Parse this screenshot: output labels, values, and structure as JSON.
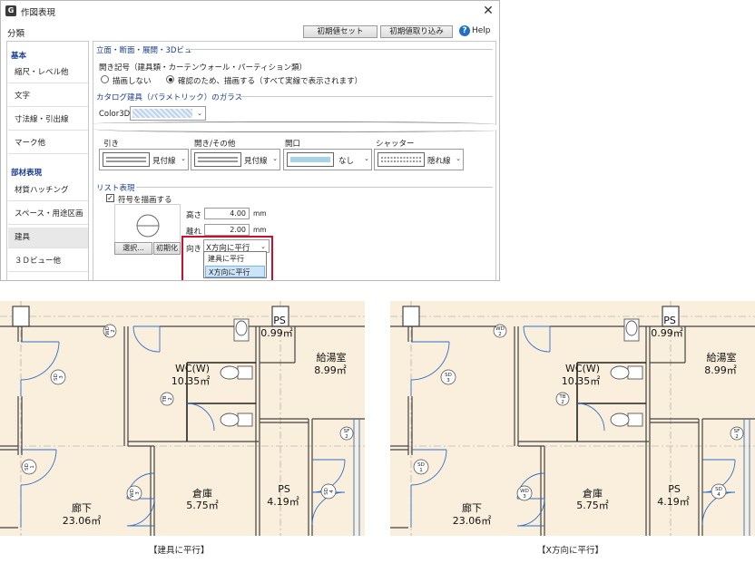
{
  "dialog": {
    "title": "作図表現",
    "close": "✕",
    "category_label": "分類",
    "buttons": {
      "initial_set": "初期値セット",
      "initial_load": "初期値取り込み"
    },
    "help": "Help"
  },
  "sidebar": {
    "head1": "基本",
    "items1": [
      "縮尺・レベル他",
      "文字",
      "寸法線・引出線",
      "マーク他"
    ],
    "head2": "部材表現",
    "items2": [
      "材質ハッチング",
      "スペース・用途区画",
      "建具",
      "３Ｄビュー他"
    ],
    "selected": "建具"
  },
  "panel": {
    "section_elev": "立面・断面・展開・3Dビュー",
    "opening_symbol_label": "開き記号（建具類・カーテンウォール・パーティション類）",
    "radio_no_draw": "描画しない",
    "radio_draw": "確認のため、描画する（すべて実線で表示されます）",
    "section_glass": "カタログ建具（パラメトリック）のガラス",
    "color3d_label": "Color3D",
    "line_types": [
      {
        "heading": "引き",
        "value": "見付線"
      },
      {
        "heading": "開き/その他",
        "value": "見付線"
      },
      {
        "heading": "開口",
        "value": "なし"
      },
      {
        "heading": "シャッター",
        "value": "隠れ線"
      }
    ],
    "section_list": "リスト表現",
    "draw_symbol_check": "符号を描画する",
    "height_label": "高さ",
    "height_value": "4.00",
    "height_unit": "mm",
    "offset_label": "離れ",
    "offset_value": "2.00",
    "offset_unit": "mm",
    "select_button": "選択...",
    "init_button": "初期化",
    "direction_label": "向き",
    "direction_value": "X方向に平行",
    "direction_options": [
      "建具に平行",
      "X方向に平行"
    ]
  },
  "plans": {
    "rooms": {
      "ps_top": "PS",
      "ps_top_area": "0.99㎡",
      "kyuto": "給湯室",
      "kyuto_area": "8.99㎡",
      "wc": "WC(W)",
      "wc_area": "10.35㎡",
      "souko": "倉庫",
      "souko_area": "5.75㎡",
      "ps_bottom": "PS",
      "ps_bottom_area": "4.19㎡",
      "rouka": "廊下",
      "rouka_area": "23.06㎡"
    },
    "tags": {
      "wd2": [
        "WD",
        "2"
      ],
      "sd3": [
        "SD",
        "3"
      ],
      "tb2": [
        "TB",
        "2"
      ],
      "sf2": [
        "SF",
        "2"
      ],
      "sd1": [
        "SD",
        "1"
      ],
      "wd3": [
        "WD",
        "3"
      ],
      "sd4": [
        "SD",
        "4"
      ]
    },
    "caption_left": "【建具に平行】",
    "caption_right": "【X方向に平行】"
  }
}
